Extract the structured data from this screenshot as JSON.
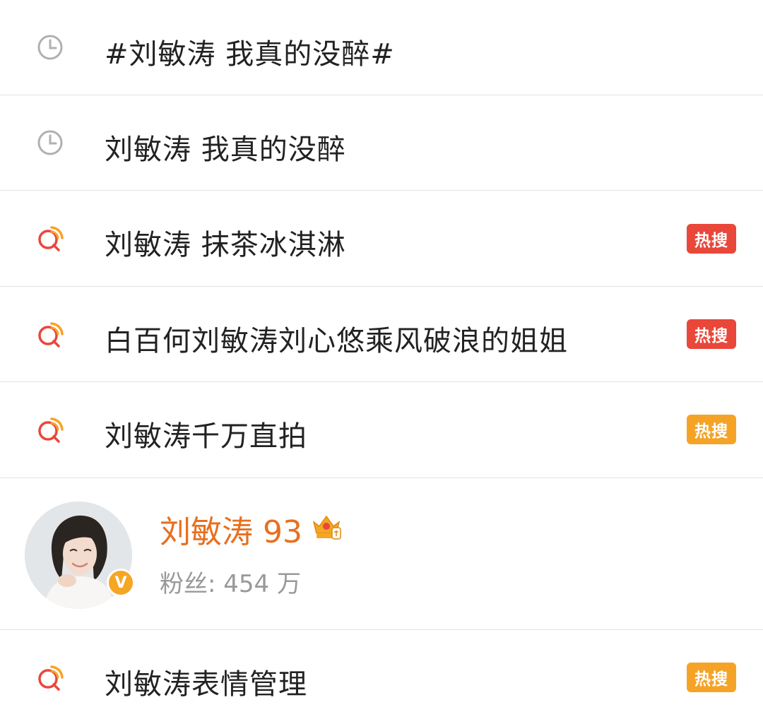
{
  "search_suggestions": {
    "history": [
      {
        "label": "#刘敏涛 我真的没醉#",
        "icon": "clock-icon"
      },
      {
        "label": "刘敏涛 我真的没醉",
        "icon": "clock-icon"
      }
    ],
    "suggestions": [
      {
        "label": "刘敏涛 抹茶冰淇淋",
        "icon": "hot-search-icon",
        "badge": "热搜",
        "badge_color": "#e8473a"
      },
      {
        "label": "白百何刘敏涛刘心悠乘风破浪的姐姐",
        "icon": "hot-search-icon",
        "badge": "热搜",
        "badge_color": "#e8473a"
      },
      {
        "label": "刘敏涛千万直拍",
        "icon": "hot-search-icon",
        "badge": "热搜",
        "badge_color": "#f5a327"
      }
    ],
    "user": {
      "name": "刘敏涛 93",
      "fans": "粉丝: 454 万",
      "verified_icon": "verified-v-icon",
      "level_icon": "crown-icon"
    },
    "more_suggestions": [
      {
        "label": "刘敏涛表情管理",
        "icon": "hot-search-icon",
        "badge": "热搜",
        "badge_color": "#f5a327"
      }
    ]
  },
  "colors": {
    "divider": "#e4e4e4",
    "text": "#222222",
    "user_name": "#e86f1f",
    "fans_text": "#999999",
    "hot_red": "#e8473a",
    "hot_orange": "#f5a327",
    "clock_gray": "#b0b0b0"
  }
}
